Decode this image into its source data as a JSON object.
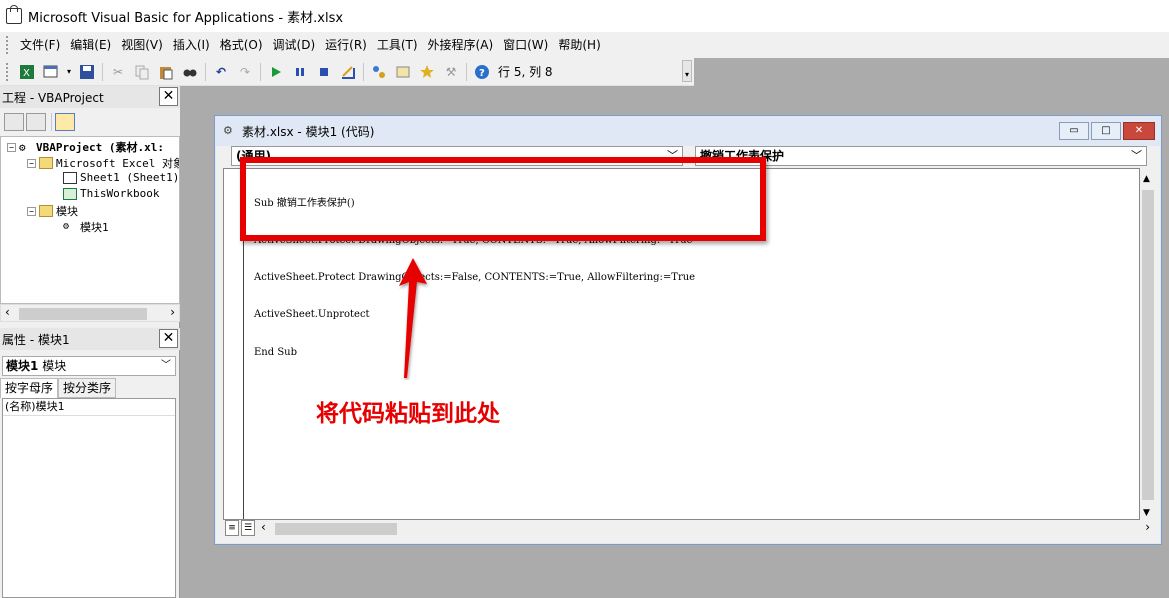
{
  "window": {
    "title": "Microsoft Visual Basic for Applications - 素材.xlsx"
  },
  "menubar": {
    "items": [
      "文件(F)",
      "编辑(E)",
      "视图(V)",
      "插入(I)",
      "格式(O)",
      "调试(D)",
      "运行(R)",
      "工具(T)",
      "外接程序(A)",
      "窗口(W)",
      "帮助(H)"
    ]
  },
  "toolbar": {
    "icons": [
      "excel-icon",
      "insert-userform-icon",
      "save-icon",
      "cut-icon",
      "copy-icon",
      "paste-icon",
      "find-icon",
      "undo-icon",
      "redo-icon",
      "run-icon",
      "break-icon",
      "reset-icon",
      "design-mode-icon",
      "project-explorer-icon",
      "properties-icon",
      "object-browser-icon",
      "toolbox-icon",
      "help-icon"
    ],
    "cursor_position": "行 5, 列 8"
  },
  "project_pane": {
    "title": "工程 - VBAProject",
    "tree": [
      {
        "label": "VBAProject (素材.xl:",
        "bold": true
      },
      {
        "label": "Microsoft Excel 对象"
      },
      {
        "label": "Sheet1 (Sheet1)"
      },
      {
        "label": "ThisWorkbook"
      },
      {
        "label": "模块"
      },
      {
        "label": "模块1"
      }
    ]
  },
  "properties_pane": {
    "title": "属性 - 模块1",
    "object_select": {
      "name": "模块1",
      "type": "模块"
    },
    "tabs": [
      "按字母序",
      "按分类序"
    ],
    "rows": [
      {
        "name": "(名称)",
        "value": "模块1"
      }
    ]
  },
  "code_window": {
    "title": "素材.xlsx - 模块1 (代码)",
    "object_combo": "(通用)",
    "procedure_combo": "撤销工作表保护",
    "code_lines": [
      "Sub 撤销工作表保护()",
      "ActiveSheet.Protect DrawingObjects:=True, CONTENTS:=True, AllowFiltering:=True",
      "ActiveSheet.Protect DrawingObjects:=False, CONTENTS:=True, AllowFiltering:=True",
      "ActiveSheet.Unprotect",
      "End Sub"
    ]
  },
  "annotation": {
    "text": "将代码粘贴到此处",
    "color": "#e60000"
  }
}
